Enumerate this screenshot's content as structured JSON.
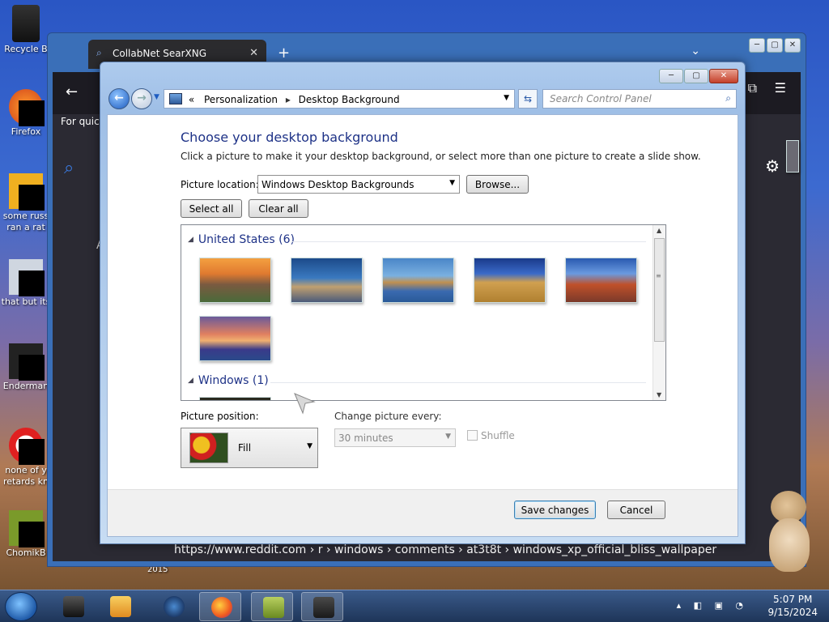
{
  "desktop": {
    "icons": [
      {
        "label": "Recycle B"
      },
      {
        "label": "Firefox"
      },
      {
        "label": "some russ",
        "label2": "ran a rat"
      },
      {
        "label": "that but its"
      },
      {
        "label": "Enderman"
      },
      {
        "label": "none of y",
        "label2": "retards kn"
      },
      {
        "label": "ChomikB"
      }
    ],
    "year_label": "2015"
  },
  "browser": {
    "tab_title": "CollabNet SearXNG",
    "tab_close": "✕",
    "new_tab": "+",
    "tab_list": "⌄",
    "back": "←",
    "for_quick": "For quick",
    "letter": "A",
    "url": "https://www.reddit.com  › r › windows › comments › at3t8t › windows_xp_official_bliss_wallpaper",
    "caption": {
      "min": "─",
      "max": "▢",
      "close": "✕"
    }
  },
  "control_panel": {
    "caption": {
      "min": "─",
      "max": "▢",
      "close": "✕"
    },
    "breadcrumb": {
      "prefix": "«",
      "part1": "Personalization",
      "sep": "▸",
      "part2": "Desktop Background"
    },
    "search_placeholder": "Search Control Panel",
    "heading": "Choose your desktop background",
    "subheading": "Click a picture to make it your desktop background, or select more than one picture to create a slide show.",
    "picture_location_label": "Picture location:",
    "picture_location_value": "Windows Desktop Backgrounds",
    "browse_label": "Browse...",
    "select_all_label": "Select all",
    "clear_all_label": "Clear all",
    "groups": [
      {
        "title": "United States (6)"
      },
      {
        "title": "Windows (1)"
      }
    ],
    "picture_position_label": "Picture position:",
    "picture_position_value": "Fill",
    "change_picture_label": "Change picture every:",
    "change_picture_value": "30 minutes",
    "shuffle_label": "Shuffle",
    "save_label": "Save changes",
    "cancel_label": "Cancel"
  },
  "taskbar": {
    "time": "5:07 PM",
    "date": "9/15/2024"
  }
}
